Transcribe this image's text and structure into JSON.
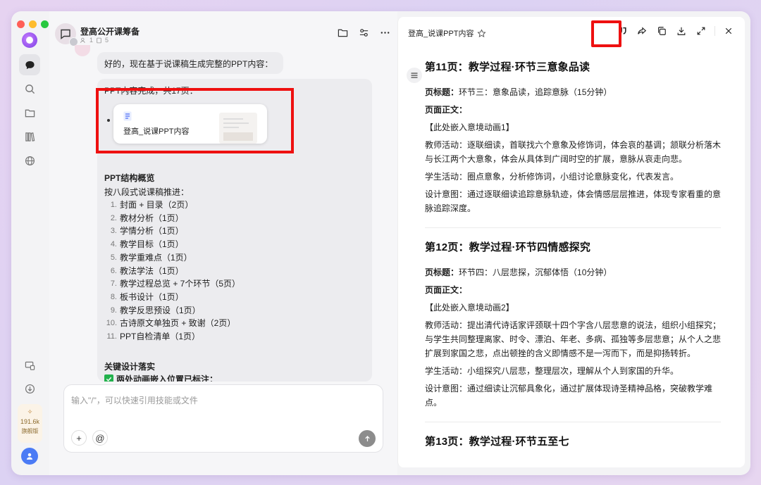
{
  "rail": {
    "credits": "191.6k",
    "tier": "旗舰版"
  },
  "chat": {
    "title": "登高公开课筹备",
    "meta_users": "1",
    "meta_files": "5",
    "message1": "好的，现在基于说课稿生成完整的PPT内容：",
    "ppt_done": "PPT内容完成，共17页：",
    "file_name": "登高_说课PPT内容",
    "structure_title": "PPT结构概览",
    "structure_intro": "按八段式说课稿推进：",
    "structure_items": [
      {
        "n": "1.",
        "t": "封面 + 目录（2页）"
      },
      {
        "n": "2.",
        "t": "教材分析（1页）"
      },
      {
        "n": "3.",
        "t": "学情分析（1页）"
      },
      {
        "n": "4.",
        "t": "教学目标（1页）"
      },
      {
        "n": "5.",
        "t": "教学重难点（1页）"
      },
      {
        "n": "6.",
        "t": "教法学法（1页）"
      },
      {
        "n": "7.",
        "t": "教学过程总览 + 7个环节（5页）"
      },
      {
        "n": "8.",
        "t": "板书设计（1页）"
      },
      {
        "n": "9.",
        "t": "教学反思预设（1页）"
      },
      {
        "n": "10.",
        "t": "古诗原文单独页 + 致谢（2页）"
      },
      {
        "n": "11.",
        "t": "PPT自检清单（1页）"
      }
    ],
    "design_title": "关键设计落实",
    "design_check": "两处动画嵌入位置已标注：",
    "composer_placeholder": "输入\"/\"，可以快速引用技能或文件"
  },
  "doc": {
    "title": "登高_说课PPT内容",
    "sections": [
      {
        "heading": "第11页：教学过程·环节三意象品读",
        "title_label": "页标题：",
        "title_value": "环节三：意象品读，追踪意脉（15分钟）",
        "body_label": "页面正文：",
        "embed": "【此处嵌入意境动画1】",
        "teacher": "教师活动：逐联细读，首联找六个意象及修饰词，体会哀的基调；颔联分析落木与长江两个大意象，体会从具体到广阔时空的扩展，意脉从哀走向悲。",
        "student": "学生活动：圈点意象，分析修饰词，小组讨论意脉变化，代表发言。",
        "intent": "设计意图：通过逐联细读追踪意脉轨迹，体会情感层层推进，体现专家看重的意脉追踪深度。"
      },
      {
        "heading": "第12页：教学过程·环节四情感探究",
        "title_label": "页标题：",
        "title_value": "环节四：八层悲探，沉郁体悟（10分钟）",
        "body_label": "页面正文：",
        "embed": "【此处嵌入意境动画2】",
        "teacher": "教师活动：提出清代诗话家评颈联十四个字含八层悲意的说法，组织小组探究；与学生共同整理离家、时令、漂泊、年老、多病、孤独等多层悲意；从个人之悲扩展到家国之悲，点出顿挫的含义即情感不是一泻而下，而是抑扬转折。",
        "student": "学生活动：小组探究八层悲，整理层次，理解从个人到家国的升华。",
        "intent": "设计意图：通过细读让沉郁具象化，通过扩展体现诗圣精神品格，突破教学难点。"
      },
      {
        "heading": "第13页：教学过程·环节五至七"
      }
    ]
  },
  "colors": {
    "highlight": "#ee1010",
    "accent": "#7b3fe4",
    "check": "#22b14c"
  }
}
